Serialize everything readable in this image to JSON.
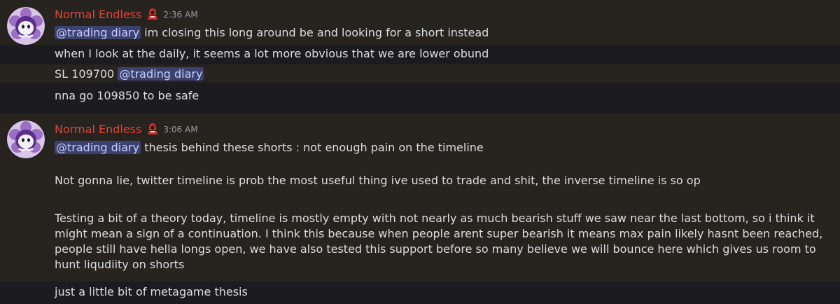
{
  "messages": [
    {
      "author": "Normal Endless",
      "timestamp": "2:36 AM",
      "lines": {
        "l1_mention": "@trading diary",
        "l1_text": "im closing this long around be and looking for a short instead",
        "l2_text": "when I look at the daily, it seems a lot more obvious that we are lower obund",
        "l3_text": "SL 109700",
        "l3_mention": "@trading diary",
        "l4_text": "nna go 109850 to be safe"
      }
    },
    {
      "author": "Normal Endless",
      "timestamp": "3:06 AM",
      "lines": {
        "l1_mention": "@trading diary",
        "l1_text": "thesis behind these shorts : not enough pain on the timeline",
        "p2": "Not gonna lie, twitter timeline is prob the most useful thing ive used to trade and shit, the inverse timeline is so op",
        "p3": "Testing a bit of a theory today, timeline is mostly empty with not nearly as much bearish stuff we saw near the last bottom, so i think it might mean a sign of a continuation. I think this because when people arent super bearish it means max pain likely hasnt been reached, people still have hella longs open, we have also tested this support before so many believe we will bounce here which gives us room to hunt liqudiity on shorts",
        "l5_text": "just a little bit of metagame thesis"
      }
    }
  ],
  "colors": {
    "author": "#e0453a",
    "mention_bg": "#3c4270",
    "mention_fg": "#c9cdfb",
    "timestamp": "#9a9ca3",
    "highlight_bg": "#27231f",
    "plain_bg": "#1c1c20"
  },
  "icons": {
    "avatar": "ghost-in-purple-flower-avatar",
    "role": "red-hooded-figure-role-icon"
  }
}
